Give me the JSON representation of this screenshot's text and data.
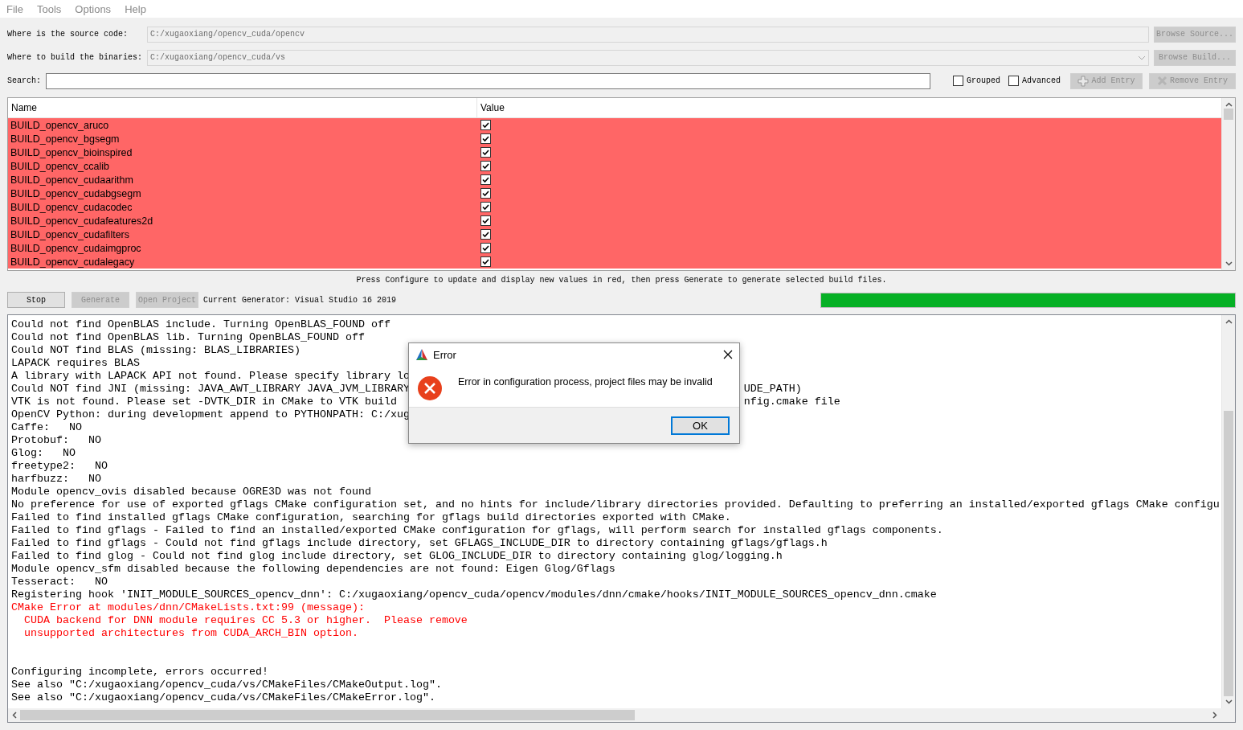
{
  "menu": [
    "File",
    "Tools",
    "Options",
    "Help"
  ],
  "source": {
    "label": "Where is the source code:",
    "value": "C:/xugaoxiang/opencv_cuda/opencv",
    "button": "Browse Source..."
  },
  "build": {
    "label": "Where to build the binaries:",
    "value": "C:/xugaoxiang/opencv_cuda/vs",
    "button": "Browse Build..."
  },
  "search": {
    "label": "Search:"
  },
  "options": [
    {
      "label": "Grouped",
      "checked": false
    },
    {
      "label": "Advanced",
      "checked": false
    }
  ],
  "entry_buttons": [
    {
      "label": "Add Entry",
      "kind": "add"
    },
    {
      "label": "Remove Entry",
      "kind": "remove"
    }
  ],
  "table": {
    "columns": [
      "Name",
      "Value"
    ],
    "rows": [
      {
        "name": "BUILD_opencv_aruco",
        "checked": true,
        "changed": true
      },
      {
        "name": "BUILD_opencv_bgsegm",
        "checked": true,
        "changed": true
      },
      {
        "name": "BUILD_opencv_bioinspired",
        "checked": true,
        "changed": true
      },
      {
        "name": "BUILD_opencv_ccalib",
        "checked": true,
        "changed": true
      },
      {
        "name": "BUILD_opencv_cudaarithm",
        "checked": true,
        "changed": true
      },
      {
        "name": "BUILD_opencv_cudabgsegm",
        "checked": true,
        "changed": true
      },
      {
        "name": "BUILD_opencv_cudacodec",
        "checked": true,
        "changed": true
      },
      {
        "name": "BUILD_opencv_cudafeatures2d",
        "checked": true,
        "changed": true
      },
      {
        "name": "BUILD_opencv_cudafilters",
        "checked": true,
        "changed": true
      },
      {
        "name": "BUILD_opencv_cudaimgproc",
        "checked": true,
        "changed": true
      },
      {
        "name": "BUILD_opencv_cudalegacy",
        "checked": true,
        "changed": true
      }
    ]
  },
  "hint": "Press Configure to update and display new values in red, then press Generate to generate selected build files.",
  "actions": [
    {
      "label": "Stop",
      "disabled": false
    },
    {
      "label": "Generate",
      "disabled": true
    },
    {
      "label": "Open Project",
      "disabled": true
    }
  ],
  "generator": "Current Generator: Visual Studio 16 2019",
  "progress": {
    "level": 1
  },
  "log": [
    {
      "kind": "normal",
      "text": "Could not find OpenBLAS include. Turning OpenBLAS_FOUND off"
    },
    {
      "kind": "normal",
      "text": "Could not find OpenBLAS lib. Turning OpenBLAS_FOUND off"
    },
    {
      "kind": "normal",
      "text": "Could NOT find BLAS (missing: BLAS_LIBRARIES)"
    },
    {
      "kind": "normal",
      "text": "LAPACK requires BLAS"
    },
    {
      "kind": "normal",
      "text": "A library with LAPACK API not found. Please specify library lo"
    },
    {
      "kind": "normal",
      "text": "Could NOT find JNI (missing: JAVA_AWT_LIBRARY JAVA_JVM_LIBRARY",
      "tail": "UDE_PATH)"
    },
    {
      "kind": "normal",
      "text": "VTK is not found. Please set -DVTK_DIR in CMake to VTK build",
      "tail": "nfig.cmake file"
    },
    {
      "kind": "normal",
      "text": "OpenCV Python: during development append to PYTHONPATH: C:/xug"
    },
    {
      "kind": "normal",
      "text": "Caffe:   NO"
    },
    {
      "kind": "normal",
      "text": "Protobuf:   NO"
    },
    {
      "kind": "normal",
      "text": "Glog:   NO"
    },
    {
      "kind": "normal",
      "text": "freetype2:   NO"
    },
    {
      "kind": "normal",
      "text": "harfbuzz:   NO"
    },
    {
      "kind": "normal",
      "text": "Module opencv_ovis disabled because OGRE3D was not found"
    },
    {
      "kind": "normal",
      "text": "No preference for use of exported gflags CMake configuration set, and no hints for include/library directories provided. Defaulting to preferring an installed/exported gflags CMake configu"
    },
    {
      "kind": "normal",
      "text": "Failed to find installed gflags CMake configuration, searching for gflags build directories exported with CMake."
    },
    {
      "kind": "normal",
      "text": "Failed to find gflags - Failed to find an installed/exported CMake configuration for gflags, will perform search for installed gflags components."
    },
    {
      "kind": "normal",
      "text": "Failed to find gflags - Could not find gflags include directory, set GFLAGS_INCLUDE_DIR to directory containing gflags/gflags.h"
    },
    {
      "kind": "normal",
      "text": "Failed to find glog - Could not find glog include directory, set GLOG_INCLUDE_DIR to directory containing glog/logging.h"
    },
    {
      "kind": "normal",
      "text": "Module opencv_sfm disabled because the following dependencies are not found: Eigen Glog/Gflags"
    },
    {
      "kind": "normal",
      "text": "Tesseract:   NO"
    },
    {
      "kind": "normal",
      "text": "Registering hook 'INIT_MODULE_SOURCES_opencv_dnn': C:/xugaoxiang/opencv_cuda/opencv/modules/dnn/cmake/hooks/INIT_MODULE_SOURCES_opencv_dnn.cmake"
    },
    {
      "kind": "error",
      "text": "CMake Error at modules/dnn/CMakeLists.txt:99 (message):"
    },
    {
      "kind": "error",
      "text": "  CUDA backend for DNN module requires CC 5.3 or higher.  Please remove"
    },
    {
      "kind": "error",
      "text": "  unsupported architectures from CUDA_ARCH_BIN option."
    },
    {
      "kind": "section",
      "text": "Configuring incomplete, errors occurred!"
    },
    {
      "kind": "normal",
      "text": "See also \"C:/xugaoxiang/opencv_cuda/vs/CMakeFiles/CMakeOutput.log\"."
    },
    {
      "kind": "normal",
      "text": "See also \"C:/xugaoxiang/opencv_cuda/vs/CMakeFiles/CMakeError.log\"."
    }
  ],
  "dialog": {
    "title": "Error",
    "message": "Error in configuration process, project files may be invalid",
    "button": "OK"
  }
}
